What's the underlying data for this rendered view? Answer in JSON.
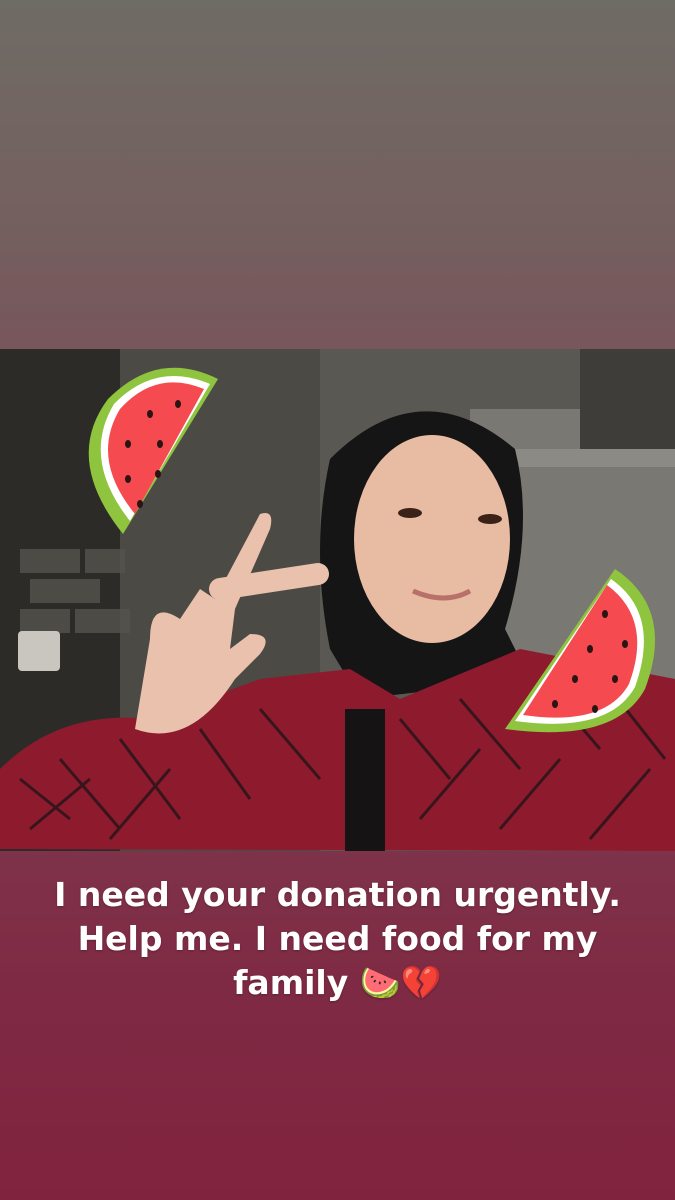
{
  "story": {
    "caption": "I need your donation urgently. Help me. I need food for my family",
    "caption_emoji": "🍉💔"
  },
  "stickers": [
    {
      "name": "watermelon-sticker",
      "emoji": "🍉"
    },
    {
      "name": "watermelon-sticker",
      "emoji": "🍉"
    }
  ],
  "colors": {
    "top_gradient": "#6f6b65",
    "bottom_gradient": "#80233f",
    "embroidery_red": "#b0223a",
    "hijab": "#141414"
  }
}
